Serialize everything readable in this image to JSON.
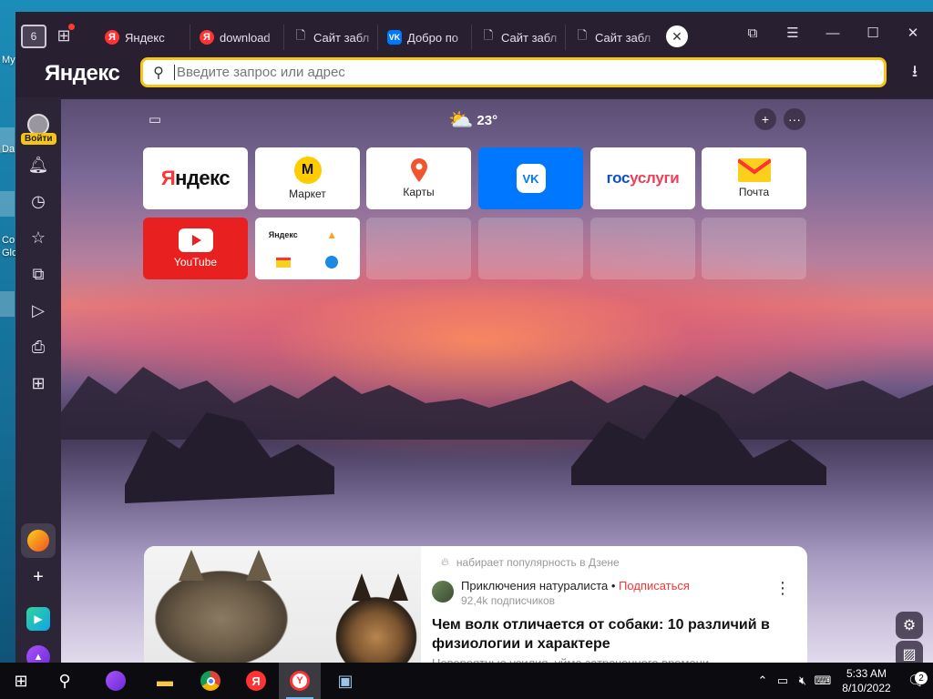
{
  "desktop": {
    "labels": [
      "My",
      "Da",
      "Co",
      "Glo"
    ]
  },
  "browser": {
    "tab_count": "6",
    "tabs": [
      {
        "favicon": "yandex-favicon",
        "title": "Яндекс"
      },
      {
        "favicon": "yandex-favicon",
        "title": "download"
      },
      {
        "favicon": "document-favicon",
        "title": "Сайт забл"
      },
      {
        "favicon": "vk-favicon",
        "title": "Добро по"
      },
      {
        "favicon": "document-favicon",
        "title": "Сайт забл"
      },
      {
        "favicon": "document-favicon",
        "title": "Сайт забл"
      }
    ],
    "logo": "Яндекс",
    "omnibox_placeholder": "Введите запрос или адрес",
    "accent": "#f5c518"
  },
  "sidebar": {
    "login_label": "Войти",
    "items": [
      "bell-icon",
      "history-icon",
      "star-icon",
      "collections-icon",
      "play-icon",
      "screenshot-icon",
      "apps-icon"
    ]
  },
  "ntp": {
    "weather": {
      "temp": "23°"
    },
    "tiles": [
      {
        "id": "yandex",
        "label": "",
        "logo": "Яндекс"
      },
      {
        "id": "market",
        "label": "Маркет"
      },
      {
        "id": "maps",
        "label": "Карты"
      },
      {
        "id": "vk",
        "label": ""
      },
      {
        "id": "gosuslugi",
        "label": "",
        "logo_a": "гос",
        "logo_b": "услуги"
      },
      {
        "id": "mail",
        "label": "Почта"
      },
      {
        "id": "youtube",
        "label": "YouTube"
      },
      {
        "id": "folder",
        "label": "",
        "sub_logo": "Яндекс"
      }
    ],
    "news": {
      "meta": "набирает популярность в Дзене",
      "channel": "Приключения натуралиста",
      "subscribe": "Подписаться",
      "subscribers": "92,4k подписчиков",
      "title": "Чем волк отличается от собаки: 10 различий в физиологии и характере",
      "snippet": "Невероятные усилия, уйма затраченного времени"
    }
  },
  "taskbar": {
    "time": "5:33 AM",
    "date": "8/10/2022",
    "notifications": "2"
  }
}
